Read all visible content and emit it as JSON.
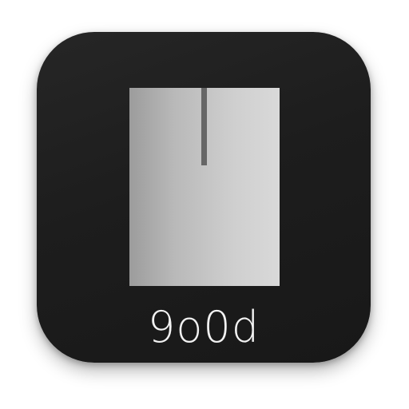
{
  "icon": {
    "label": "9o0d",
    "background_color": "#1e1e1e",
    "panel_color": "#c4c4c4",
    "indicator_color": "#666666",
    "text_color": "#f2f2f2"
  }
}
